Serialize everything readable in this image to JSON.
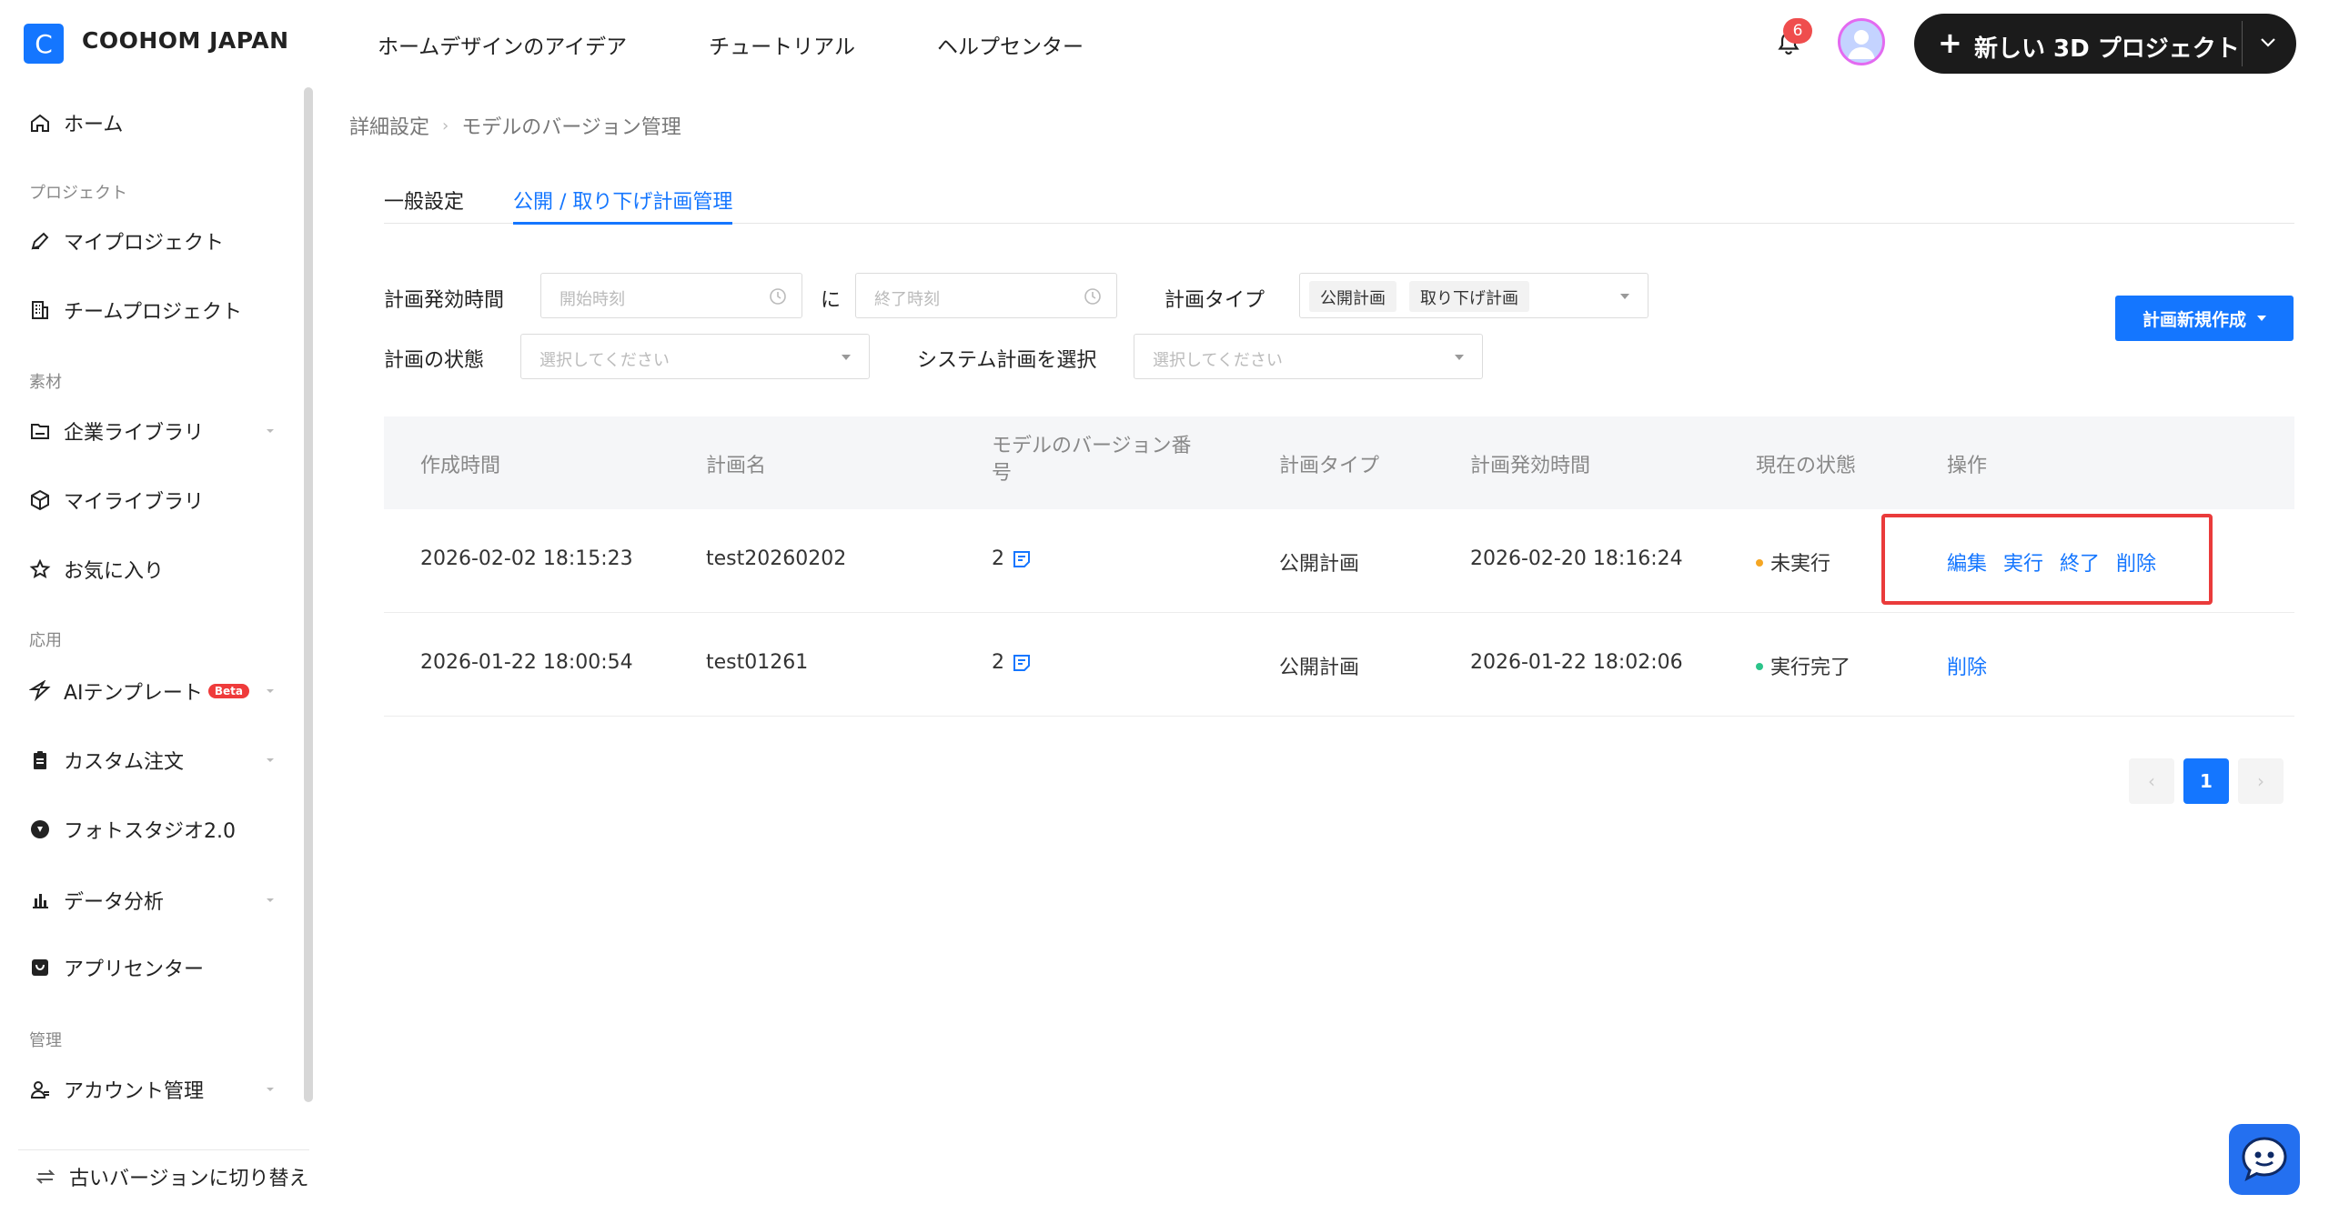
{
  "header": {
    "logo_letter": "C",
    "brand": "COOHOM JAPAN",
    "nav": [
      "ホームデザインのアイデア",
      "チュートリアル",
      "ヘルプセンター"
    ],
    "notification_count": "6",
    "new_project_label": "新しい 3D プロジェクト"
  },
  "sidebar": {
    "home": "ホーム",
    "section_project": "プロジェクト",
    "my_project": "マイプロジェクト",
    "team_project": "チームプロジェクト",
    "section_material": "素材",
    "enterprise_library": "企業ライブラリ",
    "my_library": "マイライブラリ",
    "favorites": "お気に入り",
    "section_apply": "応用",
    "ai_template": "AIテンプレート",
    "beta": "Beta",
    "custom_order": "カスタム注文",
    "photo_studio": "フォトスタジオ2.0",
    "data_analysis": "データ分析",
    "app_center": "アプリセンター",
    "section_manage": "管理",
    "account_manage": "アカウント管理",
    "old_version": "古いバージョンに切り替え"
  },
  "breadcrumb": [
    "詳細設定",
    "モデルのバージョン管理"
  ],
  "tabs": [
    "一般設定",
    "公開 / 取り下げ計画管理"
  ],
  "filters": {
    "effective_time_label": "計画発効時間",
    "start_placeholder": "開始時刻",
    "to_label": "に",
    "end_placeholder": "終了時刻",
    "plan_type_label": "計画タイプ",
    "plan_type_tags": [
      "公開計画",
      "取り下げ計画"
    ],
    "status_label": "計画の状態",
    "status_placeholder": "選択してください",
    "system_plan_label": "システム計画を選択",
    "system_plan_placeholder": "選択してください"
  },
  "new_plan_button": "計画新規作成",
  "table": {
    "headers": [
      "作成時間",
      "計画名",
      "モデルのバージョン番号",
      "計画タイプ",
      "計画発効時間",
      "現在の状態",
      "操作"
    ],
    "rows": [
      {
        "created": "2026-02-02 18:15:23",
        "name": "test20260202",
        "version": "2",
        "type": "公開計画",
        "effective": "2026-02-20 18:16:24",
        "status": "未実行",
        "status_color": "#f5a623",
        "actions": [
          "編集",
          "実行",
          "終了",
          "削除"
        ]
      },
      {
        "created": "2026-01-22 18:00:54",
        "name": "test01261",
        "version": "2",
        "type": "公開計画",
        "effective": "2026-01-22 18:02:06",
        "status": "実行完了",
        "status_color": "#2bc48a",
        "actions": [
          "削除"
        ]
      }
    ]
  },
  "pagination": {
    "current": "1",
    "prev": "‹",
    "next": "›"
  },
  "colors": {
    "accent": "#1476ff",
    "highlight": "#ea3b3b",
    "badge": "#ef4d4d"
  }
}
